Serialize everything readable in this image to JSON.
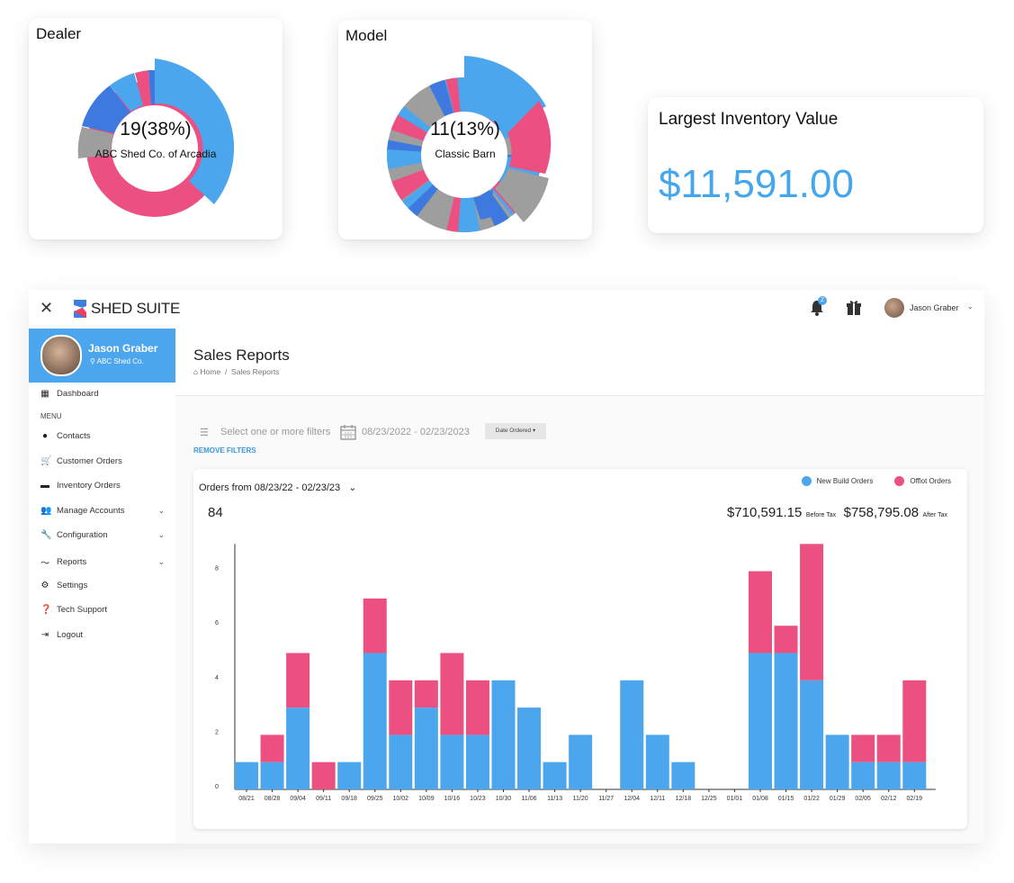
{
  "dealer_card": {
    "title": "Dealer",
    "center_value": "19(38%)",
    "center_label": "ABC Shed Co. of Arcadia"
  },
  "model_card": {
    "title": "Model",
    "center_value": "11(13%)",
    "center_label": "Classic Barn"
  },
  "inventory_card": {
    "title": "Largest Inventory Value",
    "value": "$11,591.00"
  },
  "colors": {
    "blue": "#4ba6ee",
    "pink": "#ec5080",
    "gray": "#9e9e9e",
    "dark_blue": "#3e79e0",
    "accent_text": "#44a7ee"
  },
  "topbar": {
    "close_icon": "close-icon",
    "brand": "SHED SUITE",
    "notification_count": "2",
    "user_name": "Jason Graber"
  },
  "sidebar": {
    "user_name": "Jason Graber",
    "user_company": "ABC Shed Co.",
    "dashboard": "Dashboard",
    "menu_label": "MENU",
    "items": [
      {
        "label": "Contacts",
        "icon": "account-circle-icon",
        "chevron": false
      },
      {
        "label": "Customer Orders",
        "icon": "cart-icon",
        "chevron": false
      },
      {
        "label": "Inventory Orders",
        "icon": "inventory-icon",
        "chevron": false
      },
      {
        "label": "Manage Accounts",
        "icon": "people-icon",
        "chevron": true
      },
      {
        "label": "Configuration",
        "icon": "wrench-icon",
        "chevron": true
      },
      {
        "label": "Reports",
        "icon": "trend-icon",
        "chevron": true
      },
      {
        "label": "Settings",
        "icon": "gear-icon",
        "chevron": false
      },
      {
        "label": "Tech Support",
        "icon": "help-icon",
        "chevron": false
      },
      {
        "label": "Logout",
        "icon": "logout-icon",
        "chevron": false
      }
    ]
  },
  "page": {
    "title": "Sales Reports",
    "breadcrumb_home": "Home",
    "breadcrumb_sep": "/",
    "breadcrumb_current": "Sales Reports"
  },
  "filters": {
    "placeholder": "Select one or more filters",
    "date_range": "08/23/2022 - 02/23/2023",
    "date_type": "Date Ordered",
    "remove": "REMOVE FILTERS"
  },
  "report": {
    "orders_title": "Orders from 08/23/22 - 02/23/23",
    "count": "84",
    "before_tax_value": "$710,591.15",
    "before_tax_label": "Before Tax",
    "after_tax_value": "$758,795.08",
    "after_tax_label": "After Tax"
  },
  "chart_data": {
    "type": "bar",
    "stacked": true,
    "categories": [
      "08/21",
      "08/28",
      "09/04",
      "09/11",
      "09/18",
      "09/25",
      "10/02",
      "10/09",
      "10/16",
      "10/23",
      "10/30",
      "11/06",
      "11/13",
      "11/20",
      "11/27",
      "12/04",
      "12/11",
      "12/18",
      "12/25",
      "01/01",
      "01/08",
      "01/15",
      "01/22",
      "01/29",
      "02/05",
      "02/12",
      "02/19"
    ],
    "series": [
      {
        "name": "New Build Orders",
        "color": "#4ba6ee",
        "values": [
          1,
          1,
          3,
          0,
          1,
          5,
          2,
          3,
          2,
          2,
          4,
          3,
          1,
          2,
          0,
          4,
          2,
          1,
          0,
          0,
          5,
          5,
          4,
          2,
          1,
          1,
          1
        ]
      },
      {
        "name": "Offlot Orders",
        "color": "#ec5080",
        "values": [
          0,
          1,
          2,
          1,
          0,
          2,
          2,
          1,
          3,
          2,
          0,
          0,
          0,
          0,
          0,
          0,
          0,
          0,
          0,
          0,
          3,
          1,
          5,
          0,
          1,
          1,
          3
        ]
      }
    ],
    "yticks": [
      "0",
      "2",
      "4",
      "6",
      "8"
    ],
    "ylim": [
      0,
      9
    ],
    "legend_position": "top-right",
    "grid": false
  }
}
